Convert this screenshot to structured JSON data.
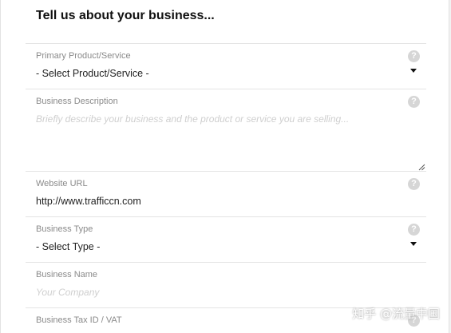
{
  "heading": "Tell us about your business...",
  "help_glyph": "?",
  "fields": {
    "primary_product": {
      "label": "Primary Product/Service",
      "value": "- Select Product/Service -"
    },
    "business_description": {
      "label": "Business Description",
      "placeholder": "Briefly describe your business and the product or service you are selling..."
    },
    "website_url": {
      "label": "Website URL",
      "value": "http://www.trafficcn.com"
    },
    "business_type": {
      "label": "Business Type",
      "value": "- Select Type -"
    },
    "business_name": {
      "label": "Business Name",
      "placeholder": "Your Company"
    },
    "business_tax_id": {
      "label": "Business Tax ID / VAT"
    }
  },
  "watermark": "知乎 @流量中国",
  "icons": {
    "help": "help-circle-icon",
    "dropdown": "caret-down-icon",
    "resize": "resize-handle-icon"
  }
}
